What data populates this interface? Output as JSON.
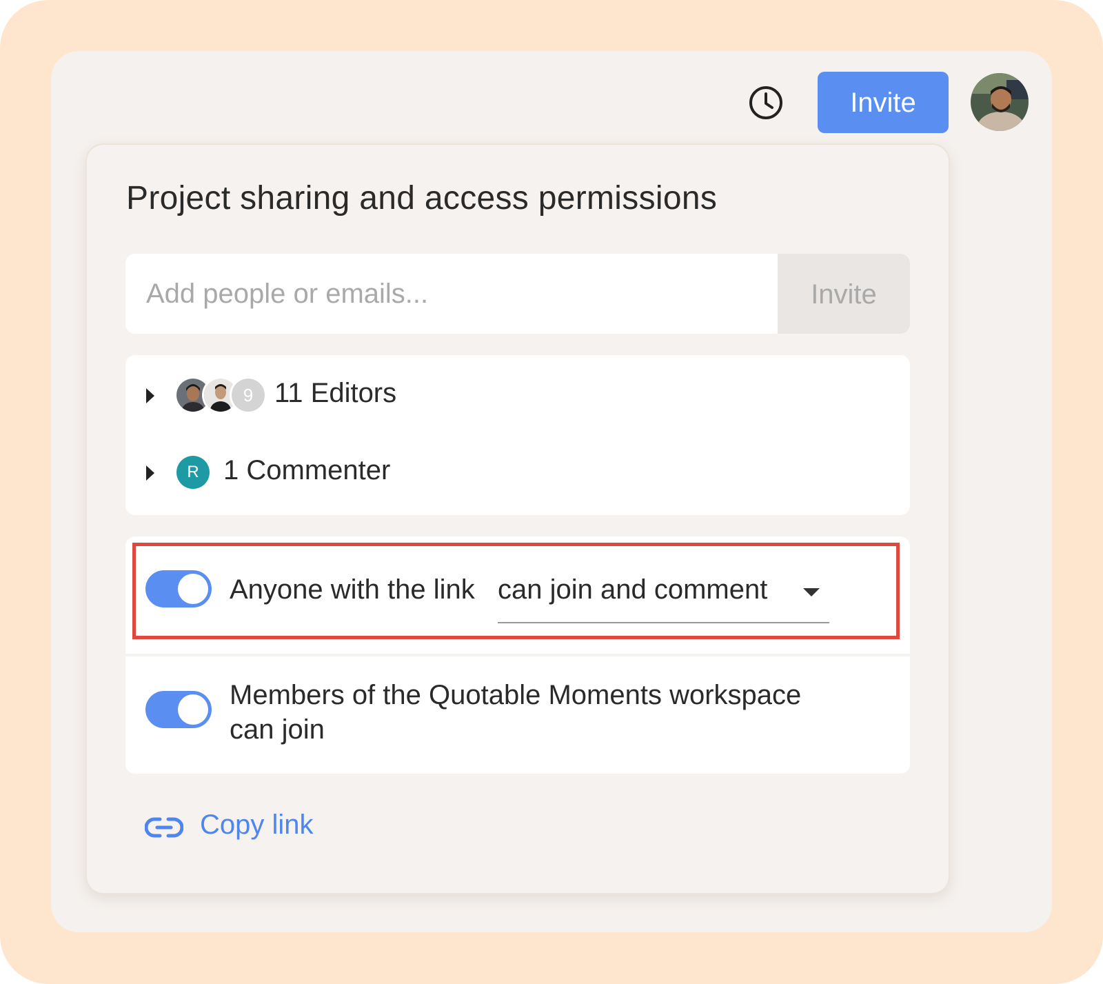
{
  "header": {
    "invite_label": "Invite"
  },
  "dialog": {
    "title": "Project sharing and access permissions",
    "invite_input": {
      "value": "",
      "placeholder": "Add people or emails..."
    },
    "invite_button_label": "Invite",
    "members": [
      {
        "label": "11 Editors",
        "extra_count": "9"
      },
      {
        "label": "1 Commenter",
        "avatar_initial": "R"
      }
    ],
    "link_access": {
      "enabled": true,
      "text_prefix": "Anyone with the link",
      "dropdown_value": "can join and comment"
    },
    "workspace_access": {
      "enabled": true,
      "text_line1": "Members of the Quotable Moments workspace",
      "text_line2": "can join"
    },
    "copy_link_label": "Copy link"
  },
  "colors": {
    "accent": "#5a8ef0",
    "highlight": "#e0483d",
    "commenter_avatar": "#1e9aa5",
    "frame": "#fde6cd"
  },
  "icons": [
    "history-icon",
    "expand-caret-icon",
    "dropdown-caret-icon",
    "link-icon"
  ]
}
